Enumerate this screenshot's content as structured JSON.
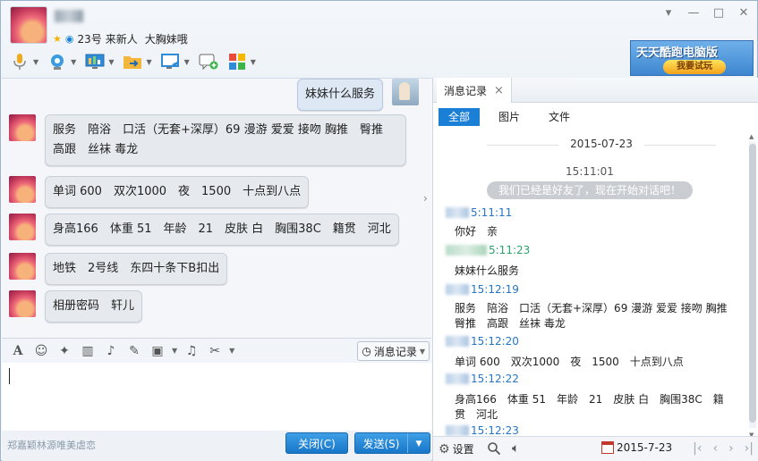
{
  "header": {
    "contact_name_visible": "",
    "level": "23号",
    "nickname_part": "来新人",
    "signature": "大胸妹哦"
  },
  "window_controls": {
    "minimize": "—",
    "maximize": "□",
    "close": "✕",
    "dropdown": "▾"
  },
  "ad": {
    "title": "天天酷跑电脑版",
    "button": "我要试玩"
  },
  "messages": [
    {
      "from": "self",
      "text": "妹妹什么服务"
    },
    {
      "from": "contact",
      "text": "服务　陪浴　口活（无套+深厚）69 漫游 爱爱 接吻 胸推　臀推　高跟　丝袜 毒龙"
    },
    {
      "from": "contact",
      "text": "单词 600　双次1000　夜　1500　十点到八点"
    },
    {
      "from": "contact",
      "text": "身高166　体重 51　年龄　21　皮肤 白　胸围38C　籍贯　河北"
    },
    {
      "from": "contact",
      "text": "地铁　2号线　东四十条下B扣出"
    },
    {
      "from": "contact",
      "text": "相册密码　轩儿"
    }
  ],
  "input_toolbar": {
    "history_button": "消息记录"
  },
  "bottom": {
    "ad_text": "郑嘉颖林源唯美虐恋",
    "close_button": "关闭(C)",
    "send_button": "发送(S)"
  },
  "history": {
    "tab_label": "消息记录",
    "filters": [
      "全部",
      "图片",
      "文件"
    ],
    "date": "2015-07-23",
    "first_time": "15:11:01",
    "system_msg": "我们已经是好友了，现在开始对话吧！",
    "entries": [
      {
        "time": "5:11:11",
        "body": "你好　亲",
        "color": "blue"
      },
      {
        "time": "5:11:23",
        "body": "妹妹什么服务",
        "color": "green"
      },
      {
        "time": "15:12:19",
        "body": "服务　陪浴　口活（无套+深厚）69 漫游 爱爱 接吻 胸推　臀推　高跟　丝袜 毒龙",
        "color": "blue"
      },
      {
        "time": "15:12:20",
        "body": "单词 600　双次1000　夜　1500　十点到八点",
        "color": "blue"
      },
      {
        "time": "15:12:22",
        "body": "身高166　体重 51　年龄　21　皮肤 白　胸围38C　籍贯　河北",
        "color": "blue"
      },
      {
        "time": "15:12:23",
        "body": "",
        "color": "blue"
      }
    ],
    "settings_label": "设置",
    "footer_date": "2015-7-23"
  }
}
